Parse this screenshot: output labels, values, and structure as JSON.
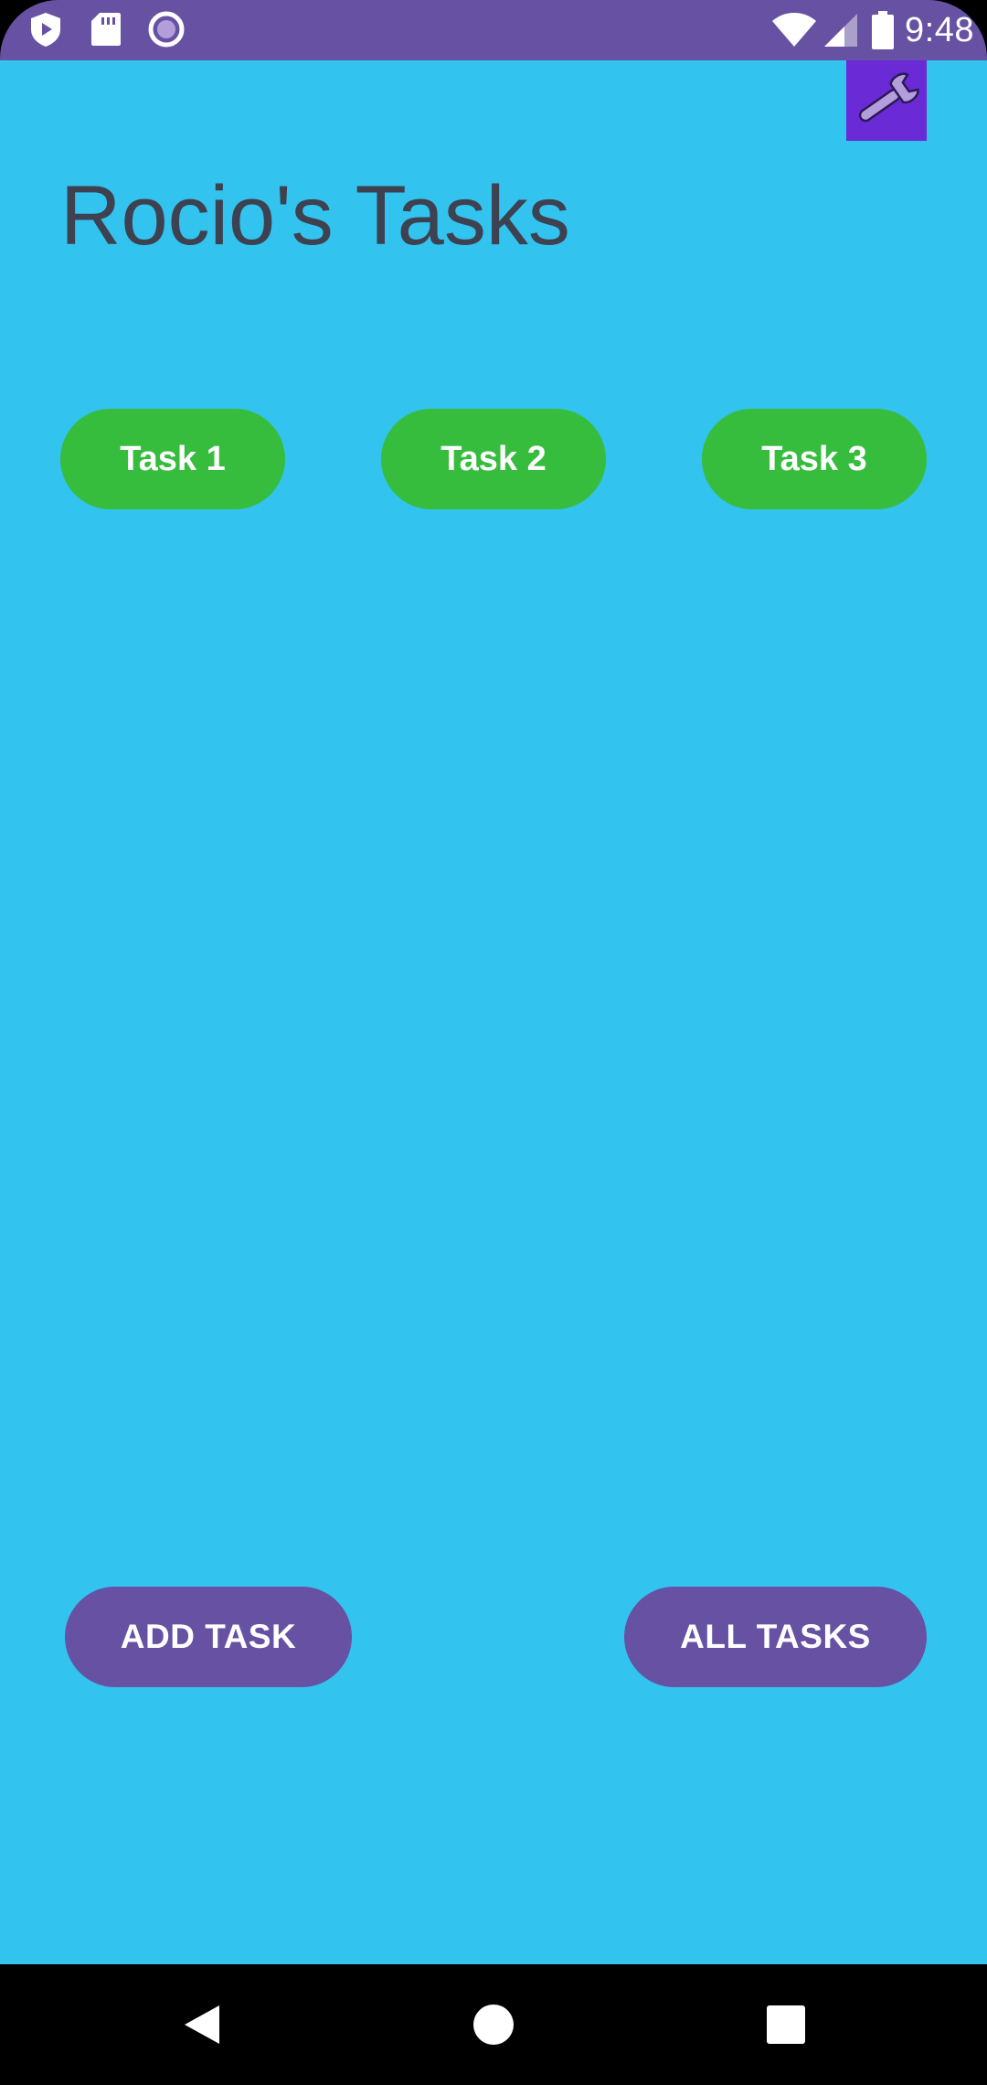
{
  "status_bar": {
    "time": "9:48",
    "left_icons": [
      "shield-play-icon",
      "sd-card-icon",
      "circle-record-icon"
    ],
    "right_icons": [
      "wifi-icon",
      "cell-signal-icon",
      "battery-icon"
    ],
    "color": "#6751a3"
  },
  "app": {
    "background_color": "#33c3ef",
    "title": "Rocio's Tasks",
    "settings_icon": "wrench-icon",
    "tasks": [
      {
        "label": "Task 1"
      },
      {
        "label": "Task 2"
      },
      {
        "label": "Task 3"
      }
    ],
    "task_button_color": "#37bd3e",
    "actions": {
      "add_task_label": "ADD TASK",
      "all_tasks_label": "ALL TASKS"
    },
    "action_button_color": "#6751a3"
  },
  "nav_bar": {
    "icons": [
      "back-icon",
      "home-icon",
      "recents-icon"
    ]
  }
}
